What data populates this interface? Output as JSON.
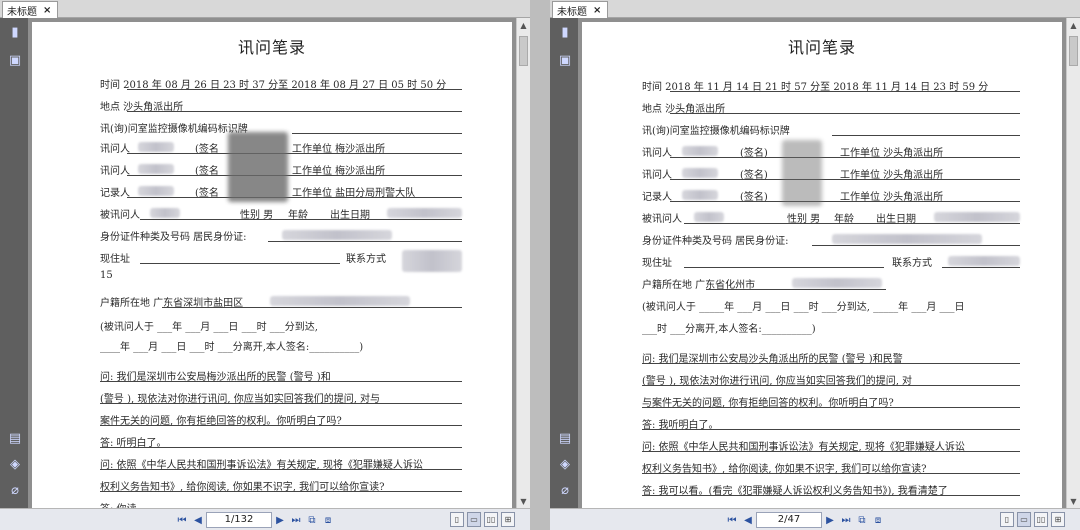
{
  "left": {
    "tab_title": "未标题",
    "tab_close": "×",
    "page_display": "1/132",
    "doc": {
      "title": "讯问笔录",
      "time_line": "时间 2018 年 08 月 26 日 23 时 37 分至 2018 年 08 月 27 日 05 时 50 分",
      "place_line": "地点 沙头角派出所",
      "camera_line": "讯(询)问室监控摄像机编码标识牌",
      "interrogator1_label": "讯问人",
      "interrogator1_sign": "(签名",
      "interrogator1_unit": "工作单位 梅沙派出所",
      "interrogator2_label": "讯问人",
      "interrogator2_sign": "(签名",
      "interrogator2_unit": "工作单位 梅沙派出所",
      "recorder_label": "记录人",
      "recorder_sign": "(签名",
      "recorder_unit": "工作单位 盐田分局刑警大队",
      "subject_label": "被讯问人",
      "gender_label": "性别 男",
      "age_label": "年龄",
      "birth_label": "出生日期",
      "id_line": "身份证件种类及号码 居民身份证:",
      "address_label": "现住址",
      "contact_label": "联系方式",
      "number_line": "15",
      "household_line": "户籍所在地 广东省深圳市盐田区",
      "arrival_line1": "(被讯问人于                    ___年 ___月 ___日 ___时 ___分到达,",
      "arrival_line2": "____年 ___月 ___日 ___时 ___分离开,本人签名:__________)",
      "q1_line1": "问: 我们是深圳市公安局梅沙派出所的民警         (警号          )和",
      "q1_line2": "    (警号       ), 现依法对你进行讯问, 你应当如实回答我们的提问, 对与",
      "q1_line3": "案件无关的问题, 你有拒绝回答的权利。你听明白了吗?",
      "a1": "答: 听明白了。",
      "q2_line1": "问: 依照《中华人民共和国刑事诉讼法》有关规定, 现将《犯罪嫌疑人诉讼",
      "q2_line2": "权利义务告知书》, 给你阅读, 你如果不识字, 我们可以给你宣读?",
      "a2": "答: 你读"
    }
  },
  "right": {
    "tab_title": "未标题",
    "tab_close": "×",
    "page_display": "2/47",
    "doc": {
      "title": "讯问笔录",
      "time_line": "时间 2018 年 11 月 14 日 21 时 57 分至 2018 年 11 月 14 日 23 时 59 分",
      "place_line": "地点 沙头角派出所",
      "camera_line": "讯(询)问室监控摄像机编码标识牌",
      "interrogator1_label": "讯问人",
      "interrogator1_sign": "(签名)",
      "interrogator1_unit": "工作单位 沙头角派出所",
      "interrogator2_label": "讯问人",
      "interrogator2_sign": "(签名)",
      "interrogator2_unit": "工作单位 沙头角派出所",
      "recorder_label": "记录人",
      "recorder_sign": "(签名)",
      "recorder_unit": "工作单位 沙头角派出所",
      "subject_label": "被讯问人",
      "gender_label": "性别 男",
      "age_label": "年龄",
      "birth_label": "出生日期",
      "id_line": "身份证件种类及号码 居民身份证:",
      "address_label": "现住址",
      "contact_label": "联系方式",
      "household_line": "户籍所在地 广东省化州市",
      "arrival_line1": "(被讯问人于 _____年 ___月 ___日 ___时 ___分到达, _____年 ___月 ___日",
      "arrival_line2": "___时 ___分离开,本人签名:__________)",
      "q1_line1": "问: 我们是深圳市公安局沙头角派出所的民警        (警号        )和民警",
      "q1_line2": "     (警号       ), 现依法对你进行讯问, 你应当如实回答我们的提问, 对",
      "q1_line3": "与案件无关的问题, 你有拒绝回答的权利。你听明白了吗?",
      "a1": "答: 我听明白了。",
      "q2_line1": "问: 依照《中华人民共和国刑事诉讼法》有关规定, 现将《犯罪嫌疑人诉讼",
      "q2_line2": "权利义务告知书》, 给你阅读, 你如果不识字, 我们可以给你宣读?",
      "a2": "答: 我可以看。(看完《犯罪嫌疑人诉讼权利义务告知书》), 我看清楚了"
    }
  }
}
